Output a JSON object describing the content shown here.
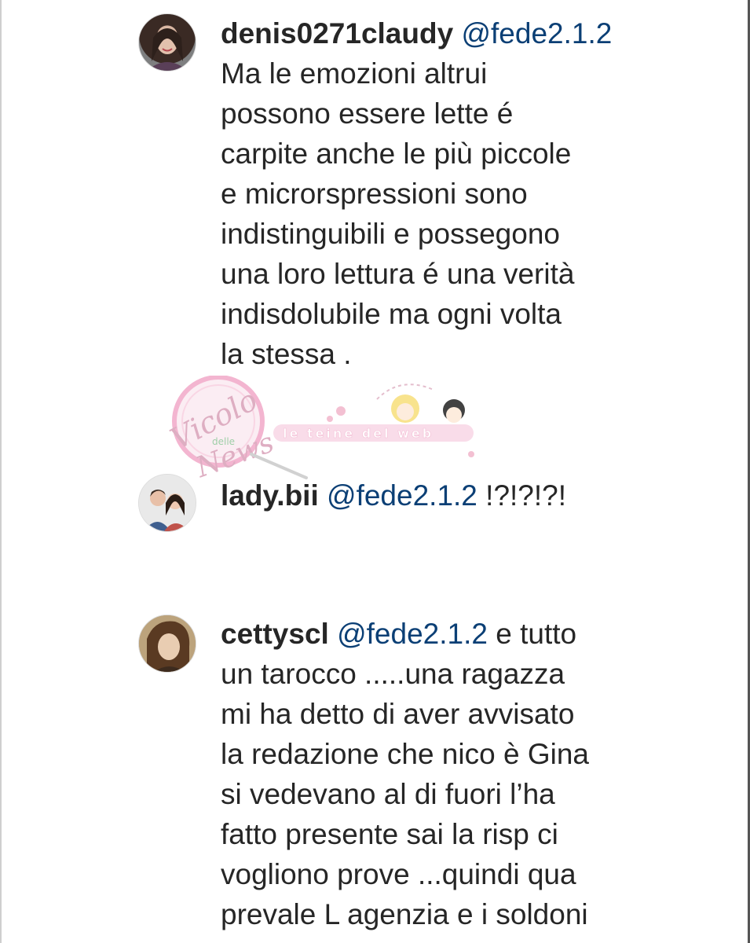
{
  "comments": [
    {
      "username": "denis0271claudy",
      "mention": "@fede2.1.2",
      "text_first": "",
      "lines": [
        "Ma le emozioni altrui",
        "possono essere lette é",
        "carpite anche le più piccole",
        "e microrspressioni sono",
        "indistinguibili e possegono",
        "una loro lettura é una verità",
        "indisdolubile ma ogni volta",
        "la stessa ."
      ]
    },
    {
      "username": "lady.bii",
      "mention": "@fede2.1.2",
      "text_first": "!?!?!?!"
    },
    {
      "username": "cettyscl",
      "mention": "@fede2.1.2",
      "text_first": "e tutto",
      "lines": [
        "un tarocco .....una ragazza",
        "mi ha detto di aver avvisato",
        "la redazione che nico è Gina",
        "si vedevano al di fuori l’ha",
        "fatto presente sai la risp ci",
        "vogliono prove ...quindi qua",
        "prevale L agenzia e i soldoni"
      ]
    }
  ],
  "watermark": {
    "script_line1": "Vicolo",
    "script_small": "delle",
    "script_line2": "News",
    "banner": "le teine del web"
  }
}
